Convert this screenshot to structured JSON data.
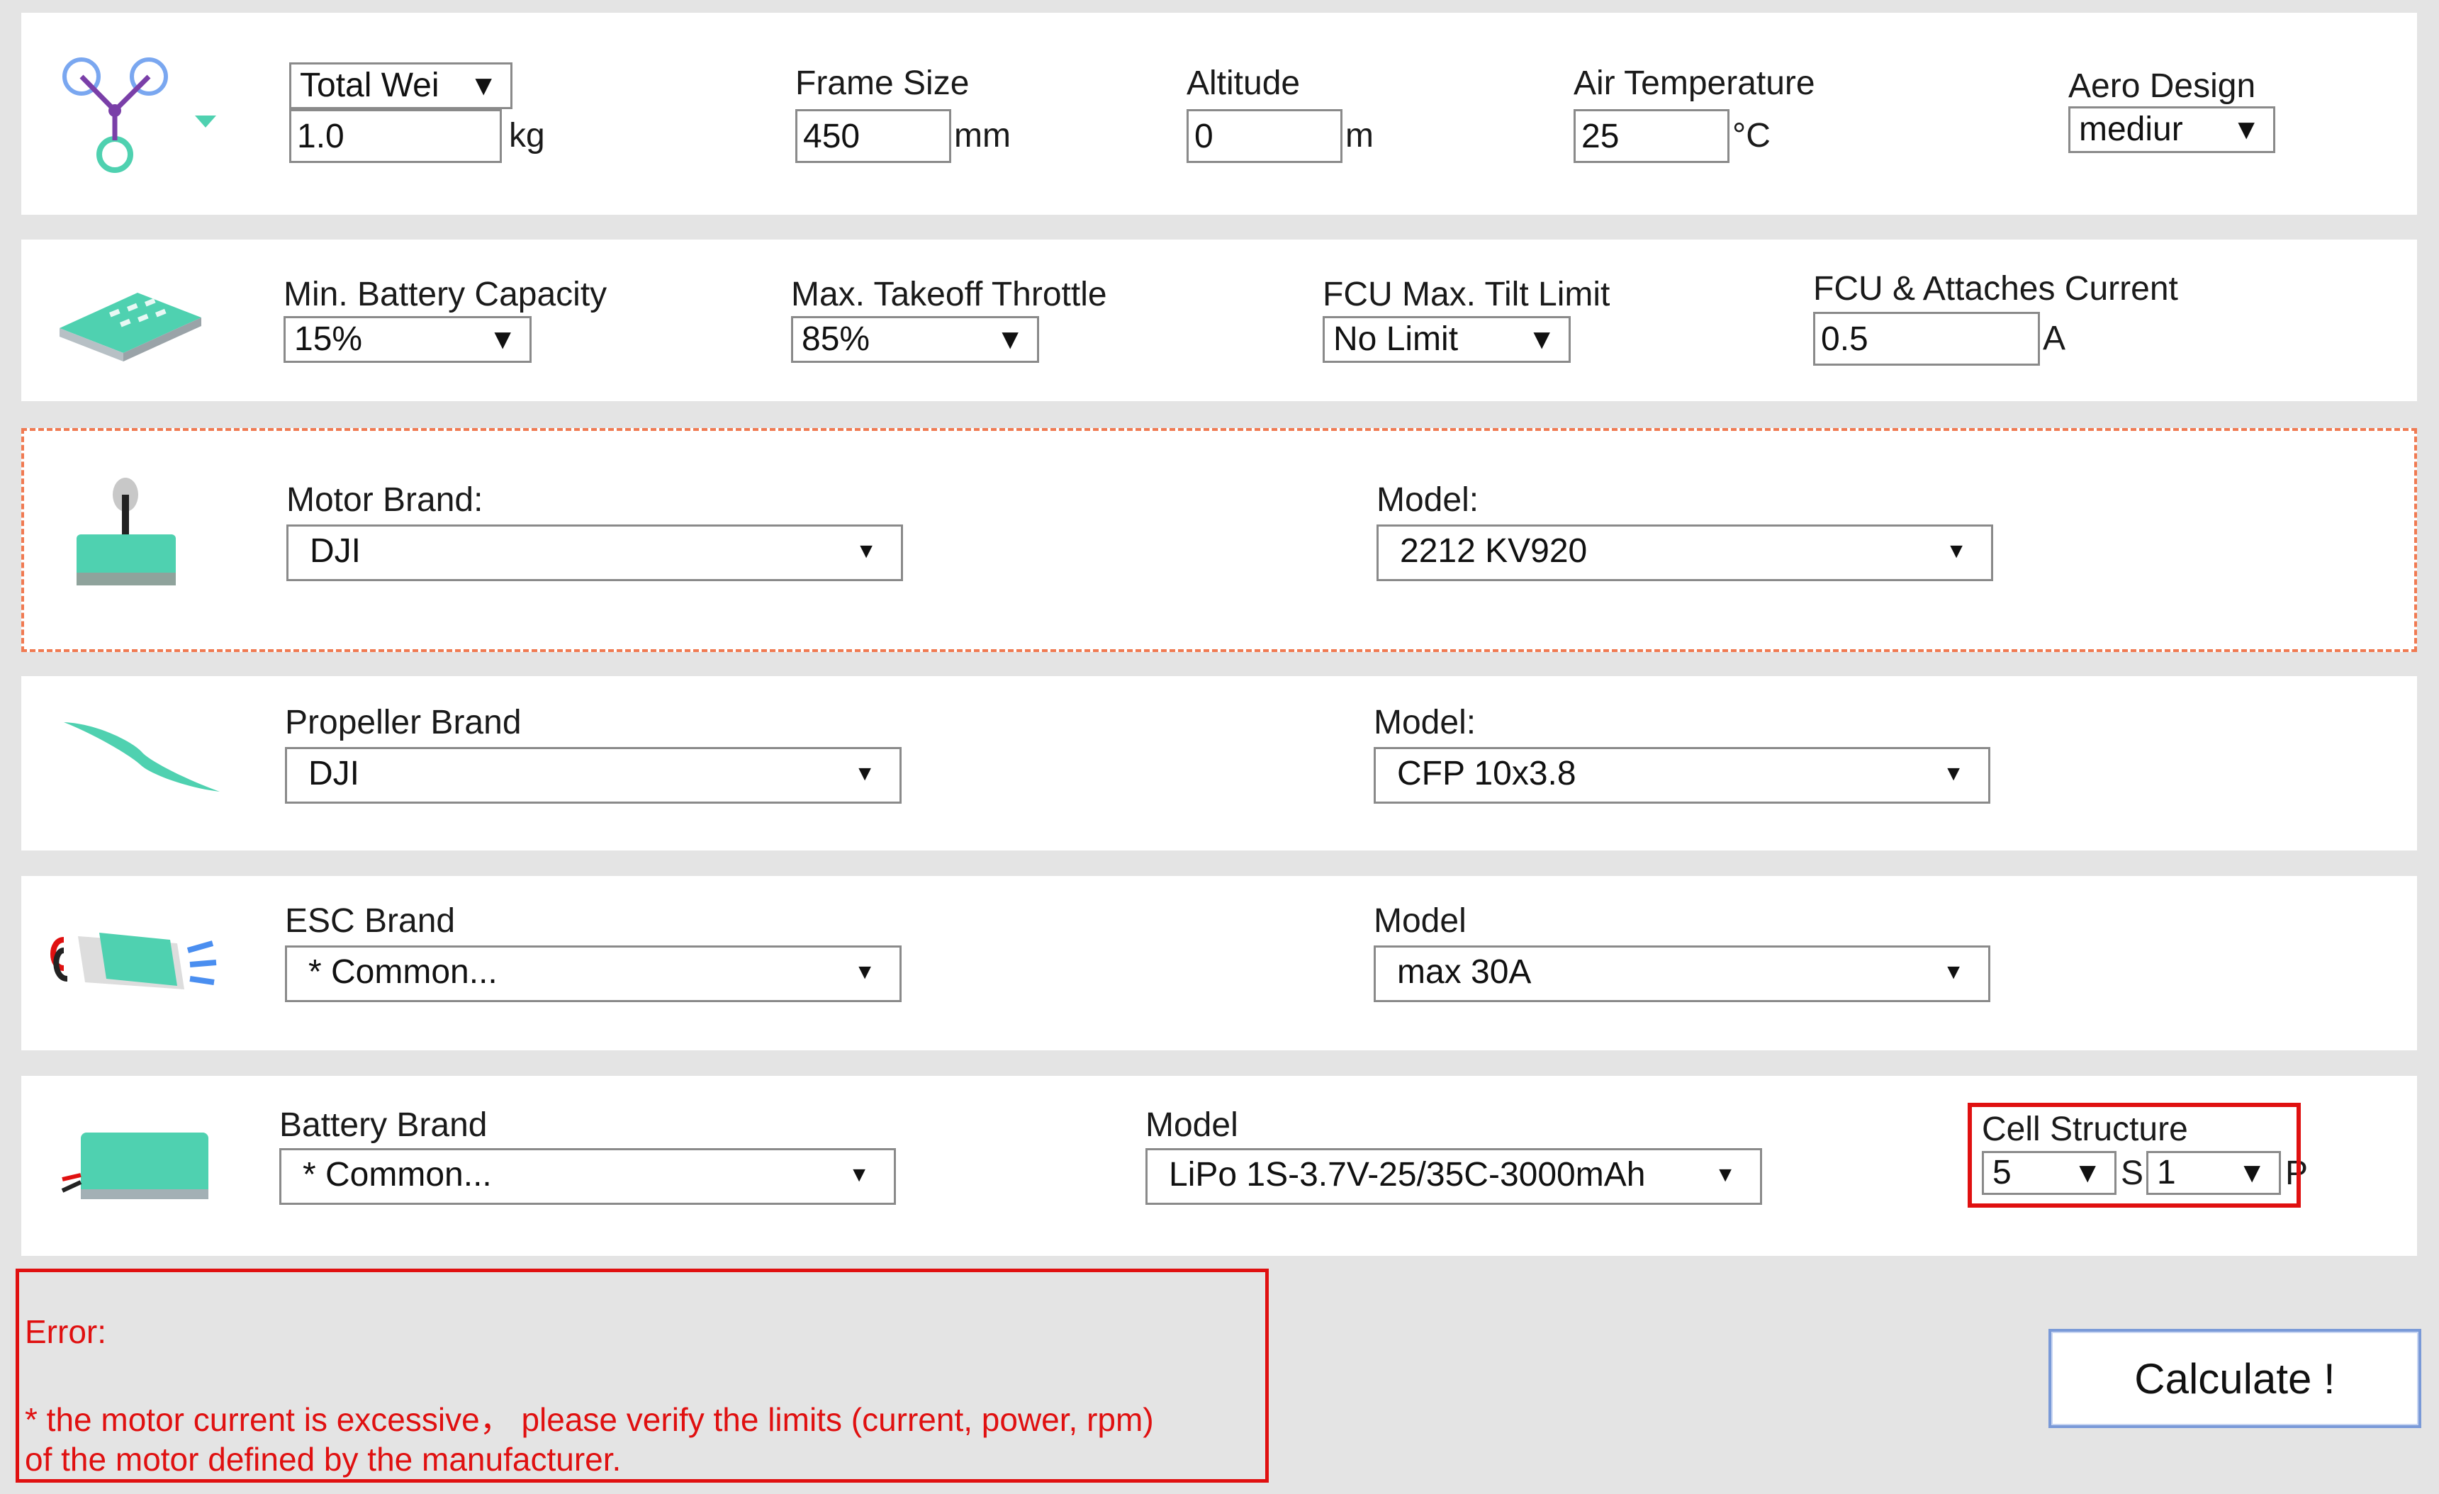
{
  "general": {
    "weight_select": "Total Wei",
    "weight_value": "1.0",
    "weight_unit": "kg",
    "frame_label": "Frame Size",
    "frame_value": "450",
    "frame_unit": "mm",
    "altitude_label": "Altitude",
    "altitude_value": "0",
    "altitude_unit": "m",
    "temp_label": "Air Temperature",
    "temp_value": "25",
    "temp_unit": "°C",
    "aero_label": "Aero Design",
    "aero_value": "mediur"
  },
  "battery_settings": {
    "min_capacity_label": "Min. Battery Capacity",
    "min_capacity_value": "15%",
    "throttle_label": "Max. Takeoff Throttle",
    "throttle_value": "85%",
    "tilt_label": "FCU Max. Tilt Limit",
    "tilt_value": "No Limit",
    "current_label": "FCU & Attaches Current",
    "current_value": "0.5",
    "current_unit": "A"
  },
  "motor": {
    "brand_label": "Motor Brand:",
    "brand_value": "DJI",
    "model_label": "Model:",
    "model_value": "2212 KV920"
  },
  "propeller": {
    "brand_label": "Propeller Brand",
    "brand_value": "DJI",
    "model_label": "Model:",
    "model_value": "CFP 10x3.8"
  },
  "esc": {
    "brand_label": "ESC Brand",
    "brand_value": "* Common...",
    "model_label": "Model",
    "model_value": "max 30A"
  },
  "battery": {
    "brand_label": "Battery Brand",
    "brand_value": "* Common...",
    "model_label": "Model",
    "model_value": "LiPo 1S-3.7V-25/35C-3000mAh",
    "cell_label": "Cell Structure",
    "cells_s": "5",
    "s_label": "S",
    "cells_p": "1",
    "p_label": "P"
  },
  "error": {
    "title": "Error:",
    "line1": "* the motor current is excessive， please verify the limits (current, power, rpm)",
    "line2": "of the motor defined by the manufacturer."
  },
  "calculate_label": "Calculate !",
  "arrow": "▼",
  "colors": {
    "accent": "#4fd1b0",
    "error": "#e01010",
    "dashed_border": "#f07a52"
  },
  "icons": {
    "row1": "quadcopter-icon",
    "row2": "battery-pack-icon",
    "row3": "motor-icon",
    "row4": "propeller-icon",
    "row5": "esc-icon",
    "row6": "lipo-battery-icon"
  }
}
